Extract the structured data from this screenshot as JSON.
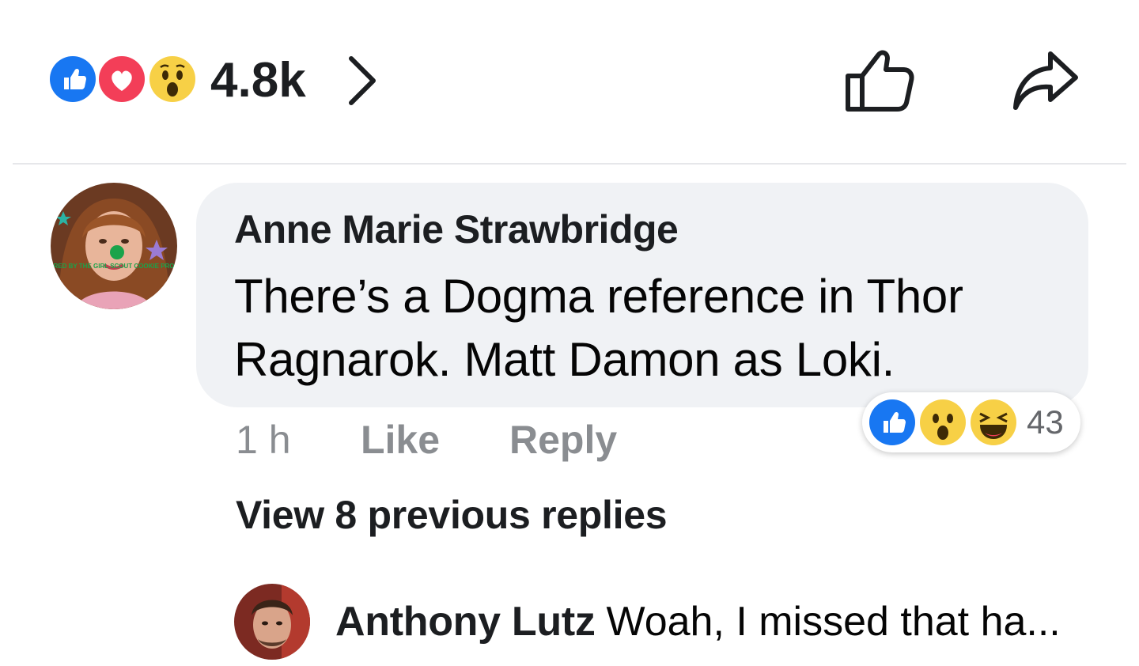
{
  "post_actions": {
    "reactions": [
      "like-icon",
      "love-icon",
      "wow-icon"
    ],
    "reaction_count": "4.8k",
    "like_button_icon": "thumbs-up-outline-icon",
    "share_button_icon": "share-arrow-icon",
    "colors": {
      "like": "#1877f2",
      "love": "#f33e58",
      "wow": "#f7b125"
    }
  },
  "comment": {
    "author": "Anne Marie Strawbridge",
    "text": "There’s a Dogma reference in Thor Ragnarok. Matt Damon as Loki.",
    "time": "1 h",
    "like_label": "Like",
    "reply_label": "Reply",
    "reactions": [
      "like-icon",
      "wow-icon",
      "haha-icon"
    ],
    "reaction_count": "43",
    "avatar_caption": "POWERED BY THE GIRL SCOUT COOKIE PROGRAM"
  },
  "view_replies_label": "View 8 previous replies",
  "reply_preview": {
    "author": "Anthony Lutz",
    "text": "Woah, I missed  that  ha..."
  }
}
